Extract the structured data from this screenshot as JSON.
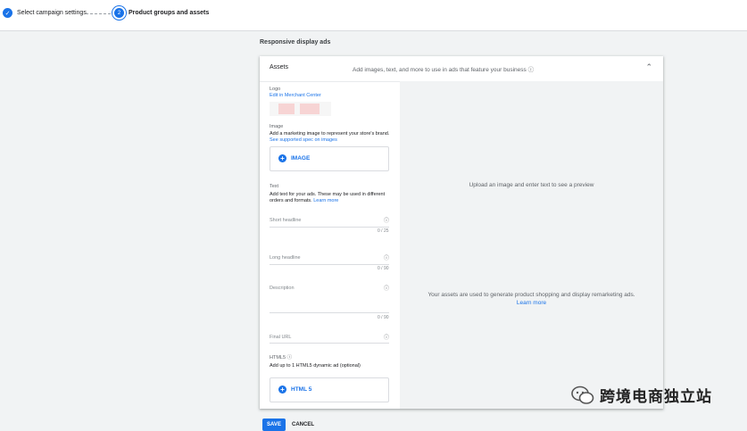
{
  "stepper": {
    "step1_label": "Select campaign settings",
    "step2_label": "Product groups and assets",
    "step2_number": "2"
  },
  "section_title": "Responsive display ads",
  "assets": {
    "title": "Assets",
    "hint": "Add images, text, and more to use in ads that feature your business",
    "logo": {
      "label": "Logo",
      "link": "Edit in Merchant Center"
    },
    "image": {
      "label": "Image",
      "desc": "Add a marketing image to represent your store's brand.",
      "link": "See supported spec on images",
      "button": "IMAGE"
    },
    "text": {
      "label": "Text",
      "desc": "Add text for your ads. These may be used in different orders and formats.",
      "link": "Learn more"
    },
    "short_headline": {
      "label": "Short headline",
      "counter": "0 / 25"
    },
    "long_headline": {
      "label": "Long headline",
      "counter": "0 / 90"
    },
    "description": {
      "label": "Description",
      "counter": "0 / 90"
    },
    "final_url": {
      "label": "Final URL"
    },
    "html5": {
      "label": "HTML5",
      "desc": "Add up to 1 HTML5 dynamic ad (optional)",
      "button": "HTML 5"
    }
  },
  "preview": {
    "top_text": "Upload an image and enter text to see a preview",
    "bottom_text": "Your assets are used to generate product shopping and display remarketing ads.",
    "bottom_link": "Learn more"
  },
  "actions": {
    "save": "SAVE",
    "cancel": "CANCEL"
  },
  "watermark": {
    "text": "跨境电商独立站"
  },
  "colors": {
    "accent": "#1a73e8",
    "preview_bg": "#f1f3f4"
  }
}
